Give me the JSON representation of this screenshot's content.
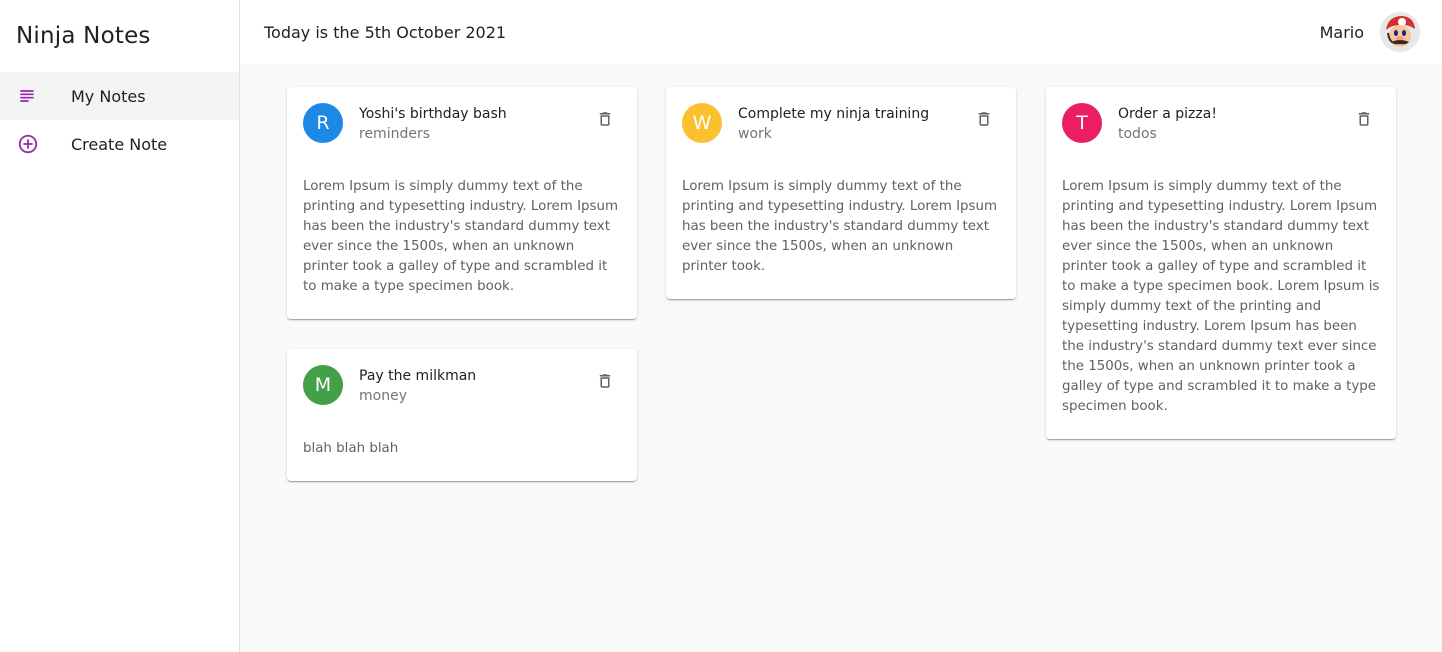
{
  "app": {
    "title": "Ninja Notes"
  },
  "sidebar": {
    "items": [
      {
        "label": "My Notes",
        "icon": "subject-icon",
        "active": true
      },
      {
        "label": "Create Note",
        "icon": "add-circle-icon",
        "active": false
      }
    ],
    "accent_color": "#9c27b0"
  },
  "header": {
    "date_text": "Today is the 5th October 2021",
    "username": "Mario"
  },
  "notes": [
    {
      "initial": "R",
      "title": "Yoshi's birthday bash",
      "category": "reminders",
      "avatar_color": "#1e88e5",
      "body": "Lorem Ipsum is simply dummy text of the printing and typesetting industry. Lorem Ipsum has been the industry's standard dummy text ever since the 1500s, when an unknown printer took a galley of type and scrambled it to make a type specimen book."
    },
    {
      "initial": "W",
      "title": "Complete my ninja training",
      "category": "work",
      "avatar_color": "#fbc02d",
      "body": "Lorem Ipsum is simply dummy text of the printing and typesetting industry. Lorem Ipsum has been the industry's standard dummy text ever since the 1500s, when an unknown printer took."
    },
    {
      "initial": "T",
      "title": "Order a pizza!",
      "category": "todos",
      "avatar_color": "#e91e63",
      "body": "Lorem Ipsum is simply dummy text of the printing and typesetting industry. Lorem Ipsum has been the industry's standard dummy text ever since the 1500s, when an unknown printer took a galley of type and scrambled it to make a type specimen book. Lorem Ipsum is simply dummy text of the printing and typesetting industry. Lorem Ipsum has been the industry's standard dummy text ever since the 1500s, when an unknown printer took a galley of type and scrambled it to make a type specimen book."
    },
    {
      "initial": "M",
      "title": "Pay the milkman",
      "category": "money",
      "avatar_color": "#43a047",
      "body": "blah blah blah"
    }
  ]
}
